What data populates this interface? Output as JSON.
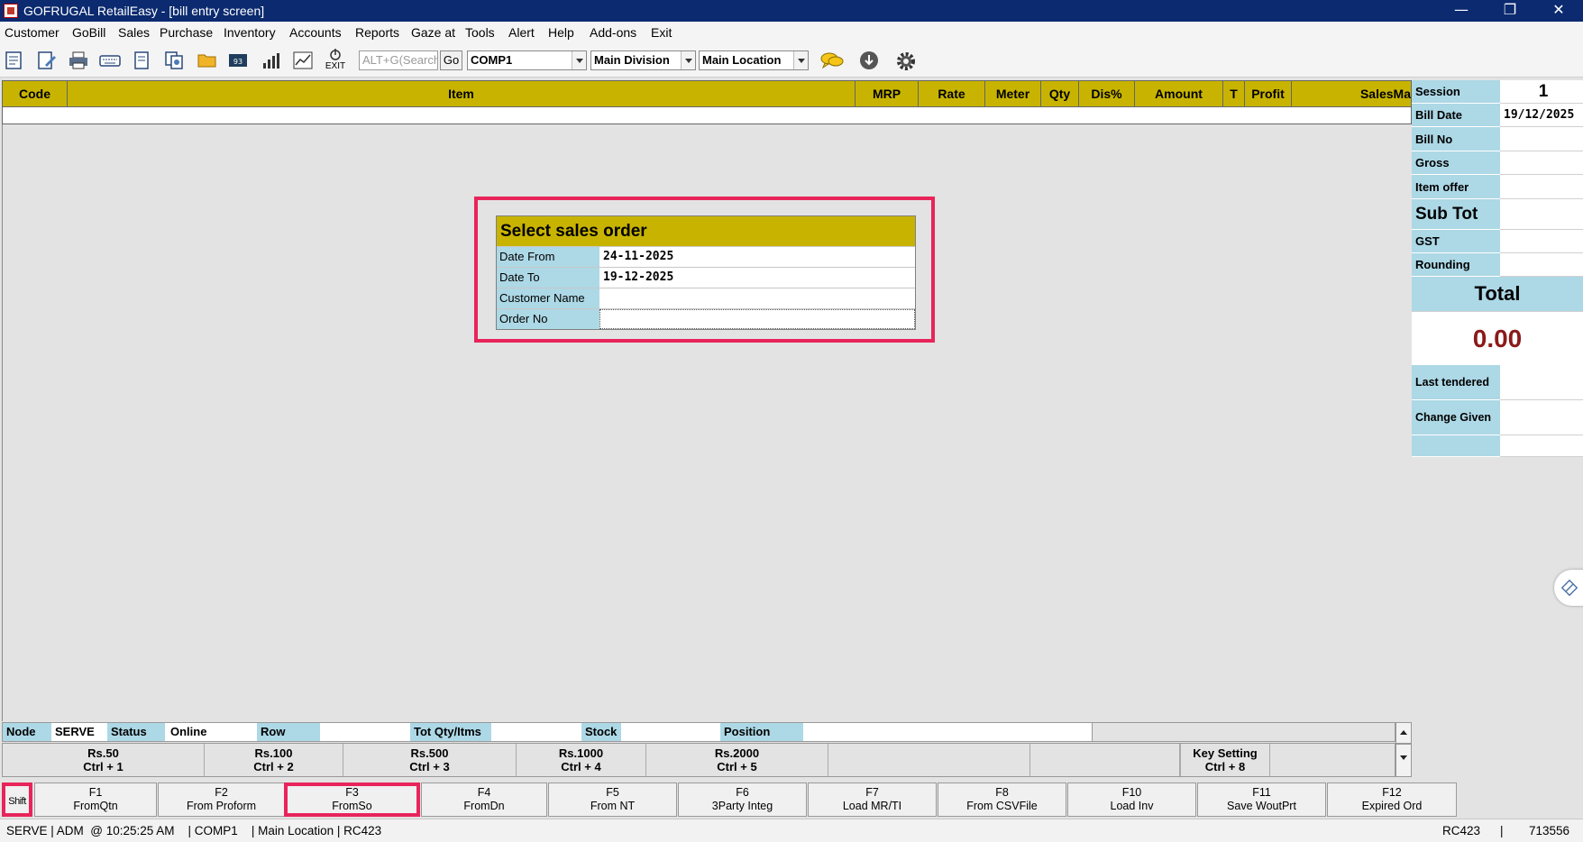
{
  "window": {
    "title": "GOFRUGAL RetailEasy - [bill entry screen]",
    "controls": [
      "—",
      "❐",
      "✕"
    ]
  },
  "menu": [
    "Customer",
    "GoBill",
    "Sales",
    "Purchase",
    "Inventory",
    "Accounts",
    "Reports",
    "Gaze at",
    "Tools",
    "Alert",
    "Help",
    "Add-ons",
    "Exit"
  ],
  "toolbar": {
    "exit_label": "EXIT",
    "search_placeholder": "ALT+G(Search",
    "go_label": "Go",
    "company": "COMP1",
    "division": "Main Division",
    "location": "Main Location",
    "icons": [
      "new-bill-icon",
      "edit-bill-icon",
      "print-icon",
      "keyboard-icon",
      "document-icon",
      "copy-document-icon",
      "open-folder-icon",
      "register-icon",
      "bar-chart-icon",
      "trend-chart-icon",
      "exit-icon",
      "chat-icon",
      "download-icon",
      "gear-icon"
    ]
  },
  "grid": {
    "columns": [
      "Code",
      "Item",
      "MRP",
      "Rate",
      "Meter",
      "Qty",
      "Dis%",
      "Amount",
      "T",
      "Profit",
      "SalesMa"
    ]
  },
  "summary": {
    "session_label": "Session",
    "session_value": "1",
    "bill_date_label": "Bill Date",
    "bill_date_value": "19/12/2025",
    "bill_no_label": "Bill No",
    "gross_label": "Gross",
    "item_offer_label": "Item offer",
    "sub_tot_label": "Sub Tot",
    "gst_label": "GST",
    "rounding_label": "Rounding",
    "total_label": "Total",
    "total_value": "0.00",
    "last_tendered_label": "Last tendered",
    "change_given_label": "Change Given",
    "total_color": "#8b1a1a"
  },
  "dialog": {
    "title": "Select sales order",
    "date_from_label": "Date From",
    "date_from_value": "24-11-2025",
    "date_to_label": "Date To",
    "date_to_value": "19-12-2025",
    "customer_name_label": "Customer Name",
    "customer_name_value": "",
    "order_no_label": "Order No",
    "order_no_value": ""
  },
  "status": {
    "node_label": "Node",
    "node_value": "SERVE",
    "status_label": "Status",
    "status_value": "Online",
    "row_label": "Row",
    "tot_qty_label": "Tot Qty/Itms",
    "stock_label": "Stock",
    "position_label": "Position"
  },
  "denominations": [
    {
      "amount": "Rs.50",
      "key": "Ctrl + 1"
    },
    {
      "amount": "Rs.100",
      "key": "Ctrl + 2"
    },
    {
      "amount": "Rs.500",
      "key": "Ctrl + 3"
    },
    {
      "amount": "Rs.1000",
      "key": "Ctrl + 4"
    },
    {
      "amount": "Rs.2000",
      "key": "Ctrl + 5"
    },
    {
      "amount": "",
      "key": ""
    },
    {
      "amount": "",
      "key": ""
    },
    {
      "amount": "Key Setting",
      "key": "Ctrl + 8"
    },
    {
      "amount": "",
      "key": ""
    }
  ],
  "fkeys": {
    "shift_label": "Shift",
    "items": [
      {
        "key": "F1",
        "label": "FromQtn"
      },
      {
        "key": "F2",
        "label": "From Proform"
      },
      {
        "key": "F3",
        "label": "FromSo"
      },
      {
        "key": "F4",
        "label": "FromDn"
      },
      {
        "key": "F5",
        "label": "From NT"
      },
      {
        "key": "F6",
        "label": "3Party Integ"
      },
      {
        "key": "F7",
        "label": "Load MR/TI"
      },
      {
        "key": "F8",
        "label": "From CSVFile"
      },
      {
        "key": "F10",
        "label": "Load Inv"
      },
      {
        "key": "F11",
        "label": "Save WoutPrt"
      },
      {
        "key": "F12",
        "label": "Expired Ord"
      }
    ]
  },
  "bottombar": {
    "left": "SERVE | ADM  @ 10:25:25 AM    | COMP1    | Main Location | RC423",
    "right_code": "RC423",
    "separator": "|",
    "right_number": "713556"
  },
  "colors": {
    "titlebar": "#0b2a6f",
    "header_yellow": "#c8b400",
    "label_blue": "#add8e6",
    "highlight": "#e8245a"
  }
}
